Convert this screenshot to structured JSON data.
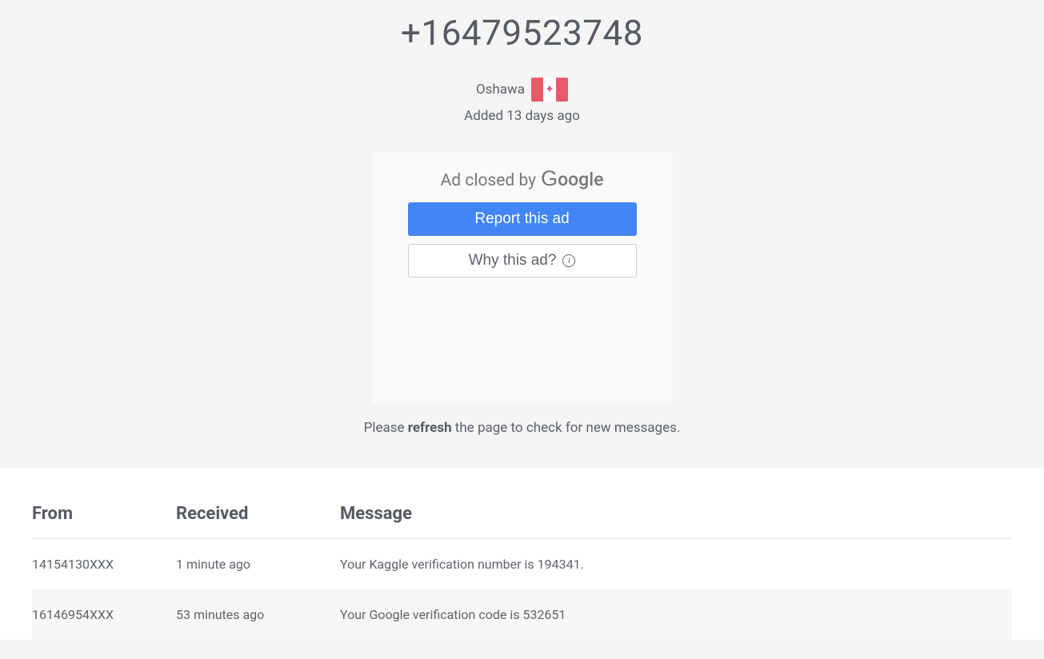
{
  "header": {
    "phone_number": "+16479523748",
    "location": "Oshawa",
    "flag_icon": "canada-flag",
    "added_text": "Added 13 days ago"
  },
  "ad": {
    "closed_prefix": "Ad closed by",
    "brand": "Google",
    "report_label": "Report this ad",
    "why_label": "Why this ad?"
  },
  "refresh_hint": {
    "prefix": "Please ",
    "bold": "refresh",
    "suffix": " the page to check for new messages."
  },
  "table": {
    "headers": {
      "from": "From",
      "received": "Received",
      "message": "Message"
    },
    "rows": [
      {
        "from": "14154130XXX",
        "received": "1 minute ago",
        "message": "Your Kaggle verification number is 194341."
      },
      {
        "from": "16146954XXX",
        "received": "53 minutes ago",
        "message": "Your Google verification code is 532651"
      }
    ]
  }
}
